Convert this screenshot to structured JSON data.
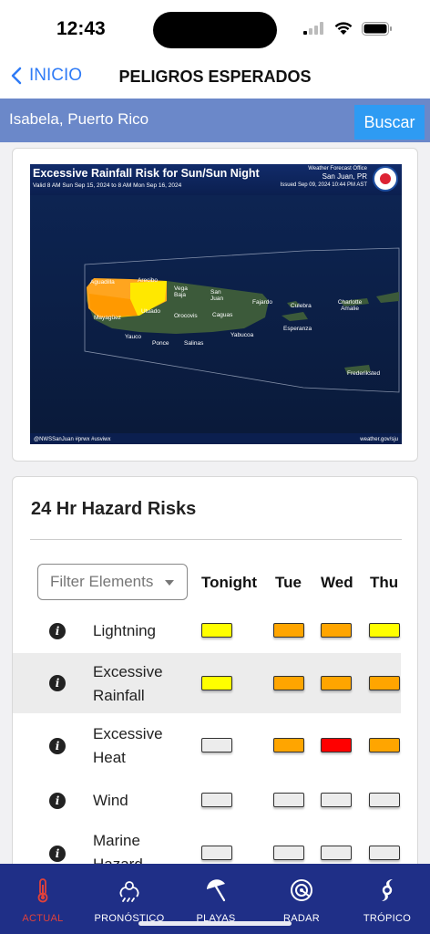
{
  "status": {
    "time": "12:43"
  },
  "nav": {
    "back_label": "INICIO",
    "title": "PELIGROS ESPERADOS"
  },
  "search": {
    "location": "Isabela, Puerto Rico",
    "button": "Buscar"
  },
  "map": {
    "title": "Excessive Rainfall Risk for Sun/Sun Night",
    "valid": "Valid 8 AM Sun Sep 15, 2024 to 8 AM Mon Sep 16, 2024",
    "office": "Weather Forecast Office",
    "city": "San Juan, PR",
    "issued": "Issued Sep 09, 2024 10:44 PM AST",
    "social": "@NWSSanJuan #prwx #usviwx",
    "web": "weather.gov/sju",
    "places": [
      "Aguadilla",
      "Arecibo",
      "Vega Baja",
      "San Juan",
      "Fajardo",
      "Culebra",
      "Charlotte Amalie",
      "Mayagüez",
      "Utuado",
      "Orocovis",
      "Caguas",
      "Esperanza",
      "Yauco",
      "Ponce",
      "Salinas",
      "Yabucoa",
      "Frederiksted"
    ]
  },
  "hazards": {
    "title": "24 Hr Hazard Risks",
    "filter_placeholder": "Filter Elements",
    "columns": [
      "Tonight",
      "Tue",
      "Wed",
      "Thu"
    ],
    "colors": {
      "yellow": "#ffff00",
      "orange": "#ffa500",
      "red": "#ff0000",
      "none": "#ececec"
    },
    "rows": [
      {
        "label": "Lightning",
        "levels": [
          "yellow",
          "orange",
          "orange",
          "yellow"
        ]
      },
      {
        "label": "Excessive Rainfall",
        "levels": [
          "yellow",
          "orange",
          "orange",
          "orange"
        ]
      },
      {
        "label": "Excessive Heat",
        "levels": [
          "none",
          "orange",
          "red",
          "orange"
        ]
      },
      {
        "label": "Wind",
        "levels": [
          "none",
          "none",
          "none",
          "none"
        ]
      },
      {
        "label": "Marine Hazard",
        "levels": [
          "none",
          "none",
          "none",
          "none"
        ]
      }
    ]
  },
  "tabs": [
    {
      "label": "ACTUAL",
      "icon": "thermometer-icon",
      "active": true
    },
    {
      "label": "PRONÓSTICO",
      "icon": "forecast-icon",
      "active": false
    },
    {
      "label": "PLAYAS",
      "icon": "beach-umbrella-icon",
      "active": false
    },
    {
      "label": "RADAR",
      "icon": "radar-icon",
      "active": false
    },
    {
      "label": "TRÓPICO",
      "icon": "hurricane-icon",
      "active": false
    }
  ]
}
